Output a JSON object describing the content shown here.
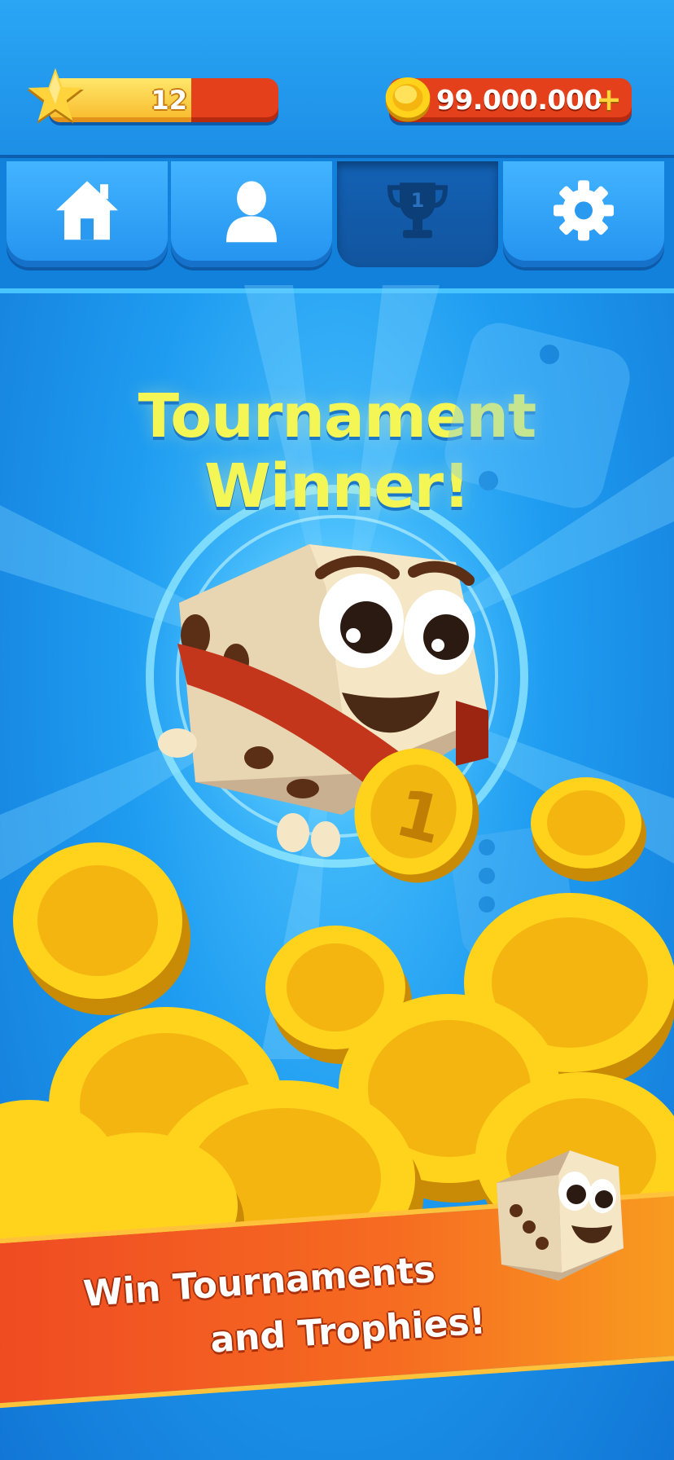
{
  "hud": {
    "level": "12",
    "xp_progress": 0.62,
    "coins": "99.000.000",
    "coins_plus": "+"
  },
  "tabs": [
    {
      "name": "home",
      "icon": "home-icon",
      "active": false
    },
    {
      "name": "profile",
      "icon": "person-icon",
      "active": false
    },
    {
      "name": "tournaments",
      "icon": "trophy-icon",
      "trophy_number": "1",
      "active": true
    },
    {
      "name": "settings",
      "icon": "gear-icon",
      "active": false
    }
  ],
  "hero": {
    "headline": "Tournament Winner!",
    "medal_number": "1"
  },
  "banner": {
    "line1": "Win Tournaments",
    "line2": "and Trophies!"
  },
  "colors": {
    "background": "#1e9cf0",
    "headline": "#f4f656",
    "banner_orange": "#f66b21",
    "coin_gold": "#ffd21c"
  }
}
